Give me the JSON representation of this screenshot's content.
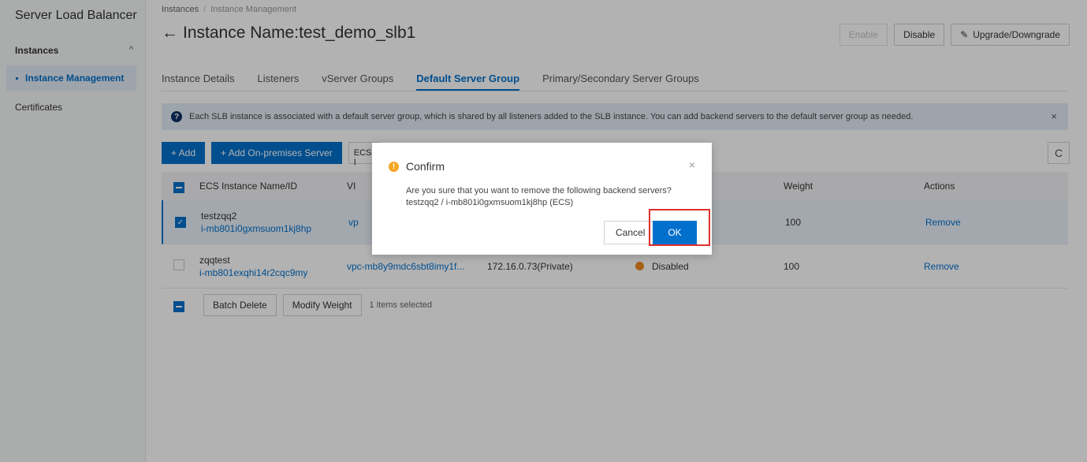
{
  "sidebar": {
    "brand": "Server Load Balancer",
    "group_label": "Instances",
    "group_chevron": "^",
    "active_item": "Instance Management",
    "certificates": "Certificates"
  },
  "breadcrumb": {
    "root": "Instances",
    "separator": "/",
    "current": "Instance Management"
  },
  "header": {
    "back_arrow": "←",
    "title": "Instance Name:test_demo_slb1",
    "enable_label": "Enable",
    "disable_label": "Disable",
    "upgrade_label": "Upgrade/Downgrade"
  },
  "tabs": [
    {
      "label": "Instance Details"
    },
    {
      "label": "Listeners"
    },
    {
      "label": "vServer Groups"
    },
    {
      "label": "Default Server Group",
      "active": true
    },
    {
      "label": "Primary/Secondary Server Groups"
    }
  ],
  "notice": {
    "icon": "?",
    "text": "Each SLB instance is associated with a default server group, which is shared by all listeners added to the SLB instance. You can add backend servers to the default server group as needed.",
    "close": "×"
  },
  "toolbar": {
    "add_label": "+ Add",
    "add_onprem_label": "+ Add On-premises Server",
    "ecs_select": "ECS I",
    "refresh_icon": "C"
  },
  "table": {
    "headers": {
      "name": "ECS Instance Name/ID",
      "vpc": "VI",
      "weight": "Weight",
      "actions": "Actions"
    },
    "rows": [
      {
        "name": "testzqq2",
        "id": "i-mb801i0gxmsuom1kj8hp",
        "vpc": "vp",
        "ip": "",
        "status": "",
        "weight": "100",
        "action": "Remove",
        "checked": true
      },
      {
        "name": "zqqtest",
        "id": "i-mb801exqhi14r2cqc9my",
        "vpc": "vpc-mb8y9mdc6sbt8imy1f...",
        "ip": "172.16.0.73(Private)",
        "status": "Disabled",
        "weight": "100",
        "action": "Remove",
        "checked": false
      }
    ]
  },
  "bottom": {
    "batch_delete": "Batch Delete",
    "modify_weight": "Modify Weight",
    "selected_text": "1 items selected"
  },
  "dialog": {
    "title": "Confirm",
    "warn_icon": "!",
    "close": "×",
    "message_line1": "Are you sure that you want to remove the following backend servers?",
    "message_line2": "testzqq2 / i-mb801i0gxmsuom1kj8hp (ECS)",
    "cancel_label": "Cancel",
    "ok_label": "OK"
  },
  "colors": {
    "accent": "#0070cc",
    "warning": "#f08c1e",
    "highlight": "#e0302c"
  }
}
